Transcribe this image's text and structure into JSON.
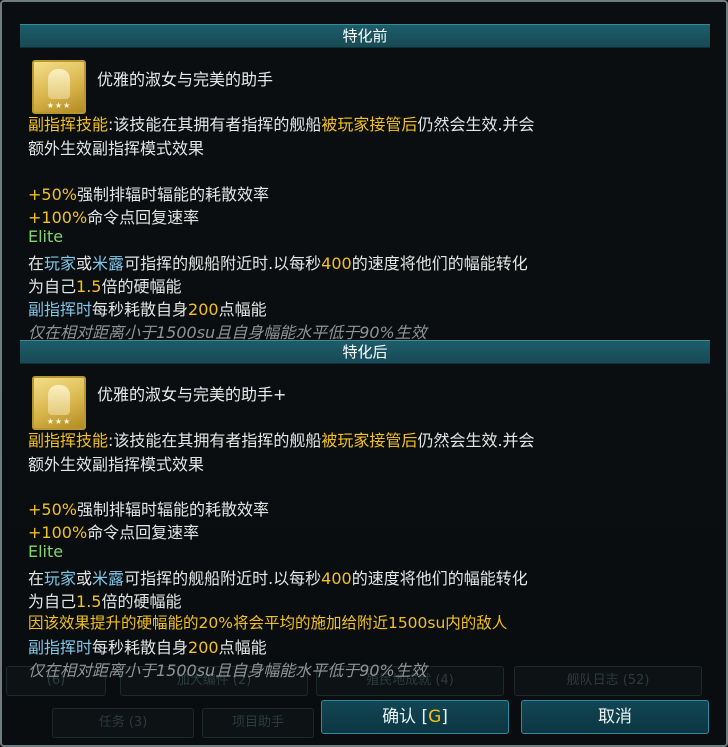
{
  "colors": {
    "highlight": "#f2c11c",
    "skill_blue": "#7ec6e8",
    "elite_green": "#83d46c",
    "text": "#e2e6e3",
    "note": "#8e9496",
    "header_bg": "#1d5c6a"
  },
  "background": {
    "row1": [
      "(6)",
      "加大编件 (2)",
      "殖民地成就 (4)",
      "舰队日志 (52)"
    ],
    "row2": [
      "任务 (3)",
      "项目助手"
    ]
  },
  "before": {
    "header": "特化前",
    "icon": "skill-portrait-icon",
    "skill_name": "优雅的淑女与完美的助手",
    "desc_1a": "副指挥技能",
    "desc_1b": ":该技能在其拥有者指挥的舰船",
    "desc_1c": "被玩家接管后",
    "desc_1d": "仍然会生效.并会",
    "desc_2": "额外生效副指挥模式效果",
    "b1_val": "+50%",
    "b1_text": "强制排辐时辐能的耗散效率",
    "b2_val": "+100%",
    "b2_text": "命令点回复速率",
    "elite": "Elite",
    "e1a": "在",
    "e1b": "玩家",
    "e1c": "或",
    "e1d": "米露",
    "e1e": "可指挥的舰船附近时.以每秒",
    "e1f": "400",
    "e1g": "的速度将他们的幅能转化",
    "e2a": "为自己",
    "e2b": "1.5",
    "e2c": "倍的硬幅能",
    "s1a": "副指挥时",
    "s1b": "每秒耗散自身",
    "s1c": "200",
    "s1d": "点幅能",
    "note": "仅在相对距离小于1500su且自身幅能水平低于90%生效"
  },
  "after": {
    "header": "特化后",
    "icon": "skill-portrait-icon",
    "skill_name": "优雅的淑女与完美的助手+",
    "desc_1a": "副指挥技能",
    "desc_1b": ":该技能在其拥有者指挥的舰船",
    "desc_1c": "被玩家接管后",
    "desc_1d": "仍然会生效.并会",
    "desc_2": "额外生效副指挥模式效果",
    "b1_val": "+50%",
    "b1_text": "强制排辐时辐能的耗散效率",
    "b2_val": "+100%",
    "b2_text": "命令点回复速率",
    "elite": "Elite",
    "e1a": "在",
    "e1b": "玩家",
    "e1c": "或",
    "e1d": "米露",
    "e1e": "可指挥的舰船附近时.以每秒",
    "e1f": "400",
    "e1g": "的速度将他们的幅能转化",
    "e2a": "为自己",
    "e2b": "1.5",
    "e2c": "倍的硬幅能",
    "upgrade": "因该效果提升的硬幅能的20%将会平均的施加给附近1500su内的敌人",
    "s1a": "副指挥时",
    "s1b": "每秒耗散自身",
    "s1c": "200",
    "s1d": "点幅能",
    "note": "仅在相对距离小于1500su且自身幅能水平低于90%生效"
  },
  "buttons": {
    "confirm_label": "确认 [",
    "confirm_hotkey": "G",
    "confirm_close": "]",
    "cancel_label": "取消"
  }
}
